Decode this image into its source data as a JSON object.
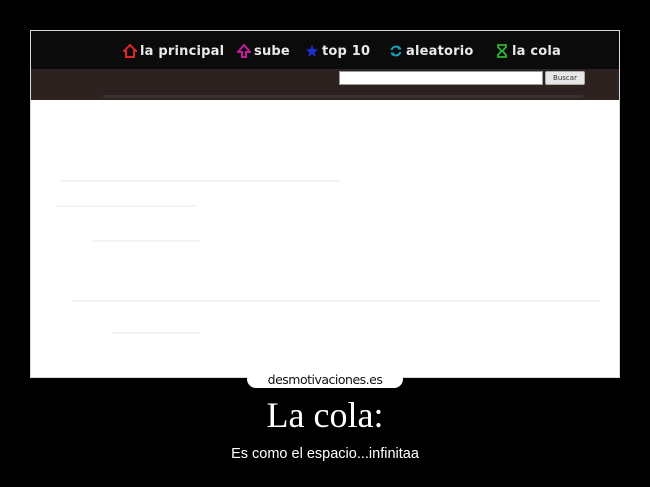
{
  "nav": {
    "items": [
      {
        "label": "la principal",
        "icon": "home-icon",
        "color": "#e0252a"
      },
      {
        "label": "sube",
        "icon": "up-arrow-icon",
        "color": "#c21c9c"
      },
      {
        "label": "top 10",
        "icon": "star-icon",
        "color": "#1d2fcf"
      },
      {
        "label": "aleatorio",
        "icon": "refresh-icon",
        "color": "#1aa0b8"
      },
      {
        "label": "la cola",
        "icon": "hourglass-icon",
        "color": "#2fb52f"
      }
    ]
  },
  "search": {
    "value": "",
    "placeholder": "",
    "button_label": "Buscar"
  },
  "brand": {
    "text": "desmotivaciones.es"
  },
  "caption": {
    "title": "La cola:",
    "subtitle": "Es como el espacio...infinitaa"
  }
}
